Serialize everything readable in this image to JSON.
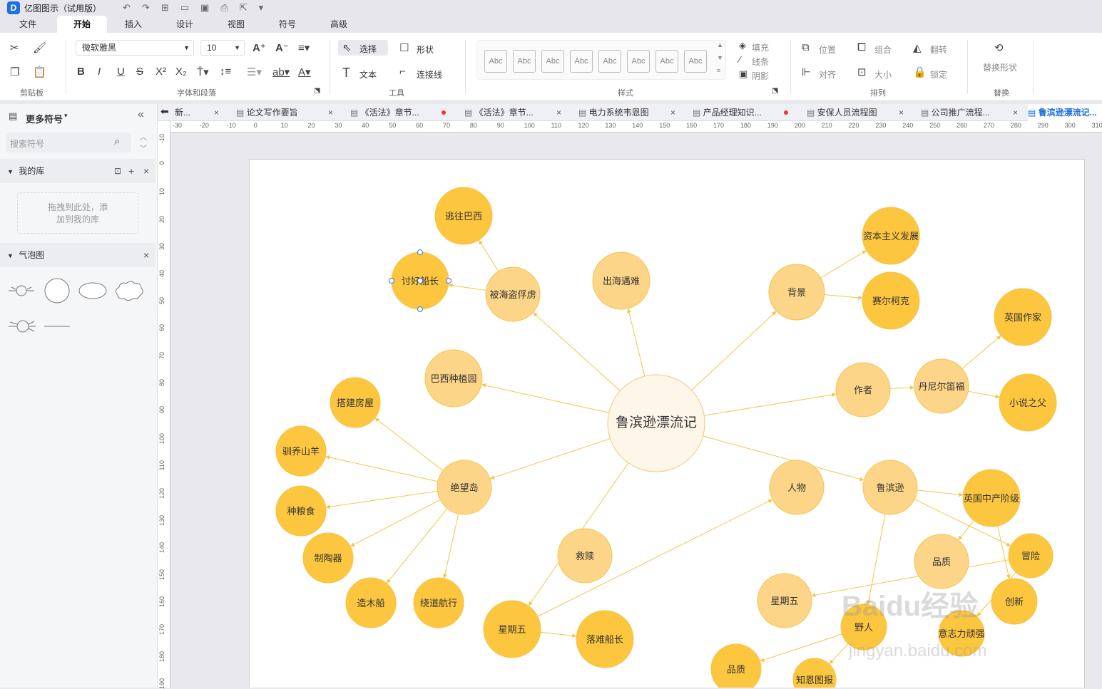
{
  "app": {
    "title": "亿图图示（试用版）",
    "logo": "D"
  },
  "menu": [
    "文件",
    "开始",
    "插入",
    "设计",
    "视图",
    "符号",
    "高级"
  ],
  "menu_active": "开始",
  "ribbon": {
    "font_name": "微软雅黑",
    "font_size": "10",
    "select": "选择",
    "text": "文本",
    "shape": "形状",
    "connector": "连接线",
    "style_thumb": "Abc",
    "fill": "填充",
    "line": "线条",
    "shadow": "阴影",
    "position": "位置",
    "group": "组合",
    "flip": "翻转",
    "align": "对齐",
    "size": "大小",
    "lock": "锁定",
    "replace_shape": "替换形状",
    "groups": {
      "clipboard": "剪贴板",
      "font": "字体和段落",
      "tools": "工具",
      "style": "样式",
      "arrange": "排列",
      "replace": "替换"
    }
  },
  "tabs": [
    {
      "label": "新...",
      "close": "×"
    },
    {
      "label": "论文写作要旨",
      "close": "×"
    },
    {
      "label": "《活法》章节...",
      "dot": true
    },
    {
      "label": "《活法》章节...",
      "close": "×"
    },
    {
      "label": "电力系统韦恩图",
      "close": "×"
    },
    {
      "label": "产品经理知识...",
      "dot": true
    },
    {
      "label": "安保人员流程图",
      "close": "×"
    },
    {
      "label": "公司推广流程...",
      "close": "×"
    },
    {
      "label": "鲁滨逊漂流记..."
    }
  ],
  "sidebar": {
    "more_symbols": "更多符号",
    "search_placeholder": "搜索符号",
    "my_library": "我的库",
    "drop_hint": "拖拽到此处，添加到我的库",
    "bubble_chart": "气泡图"
  },
  "ruler_top": [
    "-30",
    "-20",
    "-10",
    "0",
    "10",
    "20",
    "30",
    "40",
    "50",
    "60",
    "70",
    "80",
    "90",
    "100",
    "110",
    "120",
    "130",
    "140",
    "150",
    "160",
    "170",
    "180",
    "190",
    "200",
    "210",
    "220",
    "230",
    "240",
    "250",
    "260",
    "270",
    "280",
    "290",
    "300",
    "310"
  ],
  "ruler_left": [
    "-10",
    "0",
    "10",
    "20",
    "30",
    "40",
    "50",
    "60",
    "70",
    "80",
    "90",
    "100",
    "110",
    "120",
    "130",
    "140",
    "150",
    "160",
    "170",
    "180",
    "190"
  ],
  "diagram": {
    "center": "鲁滨逊漂流记",
    "nodes": [
      "逃往巴西",
      "讨好船长",
      "被海盗俘虏",
      "出海遇难",
      "背景",
      "资本主义发展",
      "赛尔柯克",
      "英国作家",
      "作者",
      "丹尼尔笛福",
      "小说之父",
      "巴西种植园",
      "搭建房屋",
      "驯养山羊",
      "绝望岛",
      "种粮食",
      "制陶器",
      "造木船",
      "绕道航行",
      "救赎",
      "星期五",
      "落难船长",
      "人物",
      "鲁滨逊",
      "英国中产阶级",
      "品质",
      "冒险",
      "创新",
      "意志力顽强",
      "星期五",
      "野人",
      "品质",
      "知恩图报"
    ]
  },
  "colors": {
    "node_dark": "#fdc63f",
    "node_light": "#fdd588",
    "center": "#fff6ea",
    "edge": "#f7c548"
  },
  "watermark": {
    "main": "Baidu经验",
    "sub": "jingyan.baidu.com"
  }
}
